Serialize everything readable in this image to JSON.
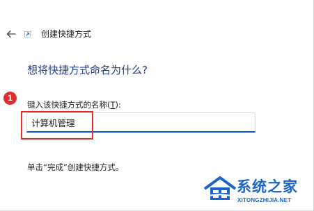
{
  "window": {
    "title": "创建快捷方式"
  },
  "main": {
    "heading": "想将快捷方式命名为什么?",
    "step_number": "1",
    "name_label_prefix": "键入该快捷方式的名称(",
    "name_label_hotkey": "T",
    "name_label_suffix": "):",
    "name_value": "计算机管理",
    "footer": "单击“完成”创建快捷方式。"
  },
  "watermark": {
    "name": "系统之家",
    "url": "XITONGZHIJIA.NET"
  },
  "colors": {
    "accent": "#0a58c7",
    "heading": "#1f3b8f",
    "annotation_red": "#e02d2d",
    "watermark_blue": "#1c64c8"
  }
}
